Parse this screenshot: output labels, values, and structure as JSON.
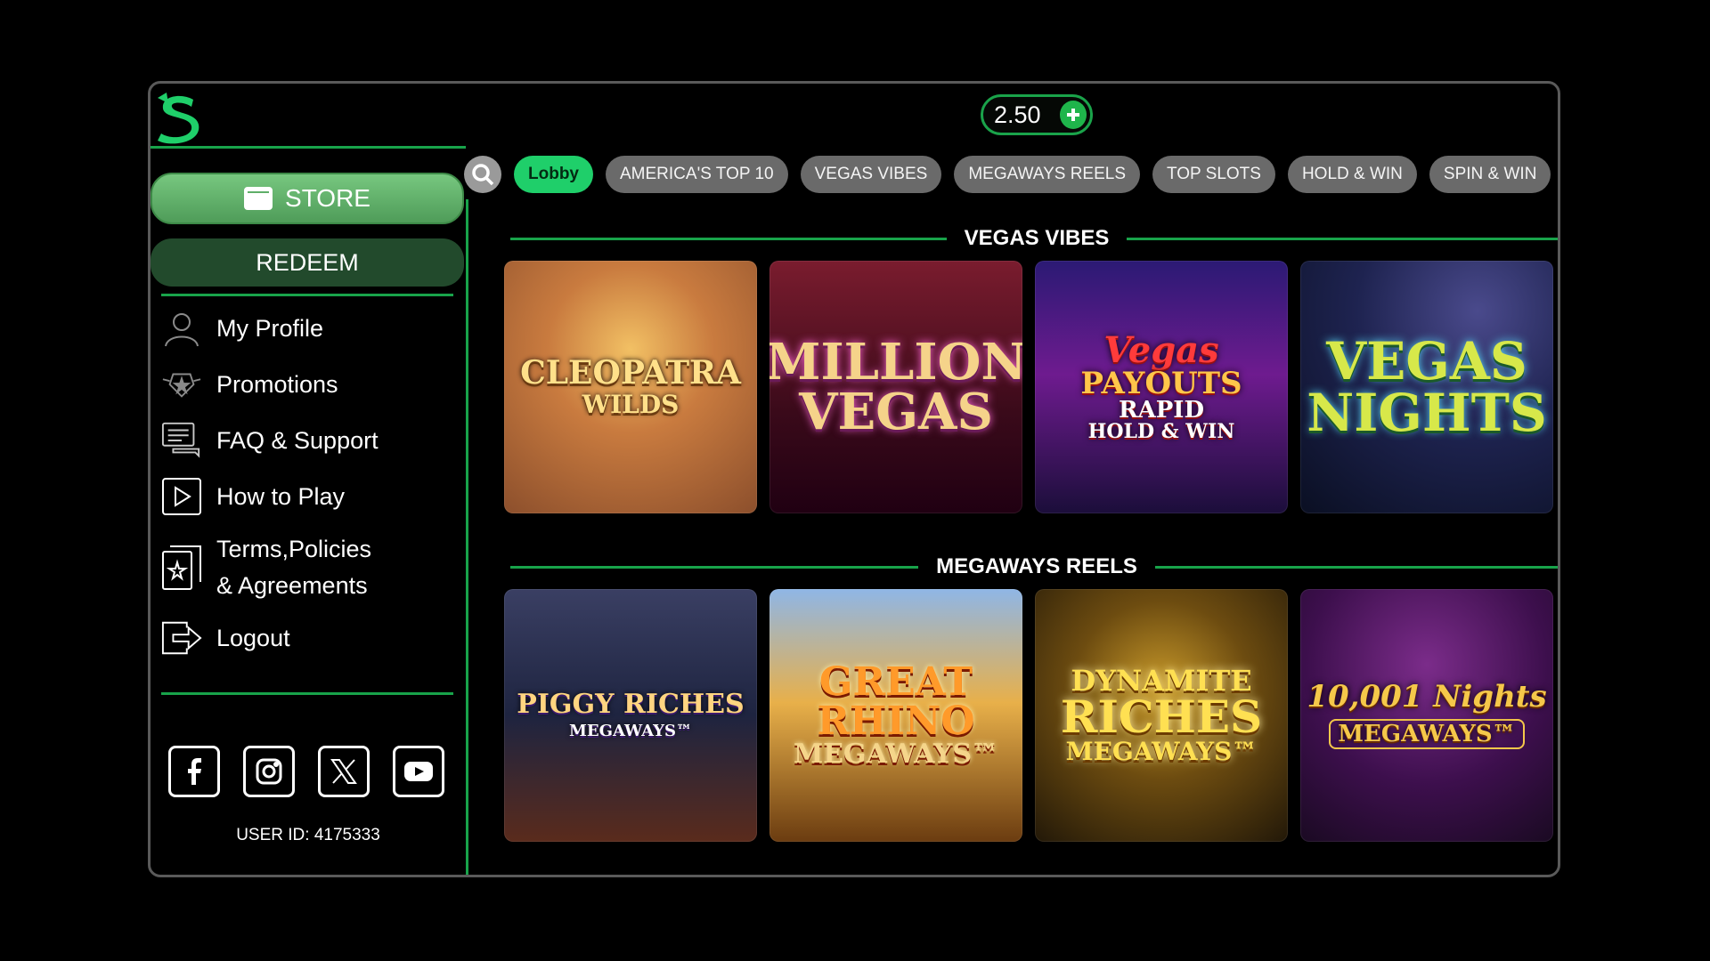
{
  "balance": {
    "amount": "2.50"
  },
  "sidebar": {
    "store_label": "STORE",
    "redeem_label": "REDEEM",
    "items": [
      {
        "label": "My Profile",
        "icon": "user-icon"
      },
      {
        "label": "Promotions",
        "icon": "badge-star-icon"
      },
      {
        "label": "FAQ & Support",
        "icon": "chat-icon"
      },
      {
        "label": "How to Play",
        "icon": "play-icon"
      },
      {
        "label": "Terms,Policies",
        "label2": "& Agreements",
        "icon": "document-star-icon"
      },
      {
        "label": "Logout",
        "icon": "logout-icon"
      }
    ],
    "socials": [
      "facebook-icon",
      "instagram-icon",
      "x-icon",
      "youtube-icon"
    ],
    "user_id": "USER ID: 4175333"
  },
  "tabs": [
    "Lobby",
    "AMERICA'S TOP 10",
    "VEGAS VIBES",
    "MEGAWAYS REELS",
    "TOP SLOTS",
    "HOLD & WIN",
    "SPIN & WIN"
  ],
  "active_tab": "Lobby",
  "sections": [
    {
      "title": "VEGAS VIBES",
      "games": [
        {
          "line1": "CLEOPATRA",
          "line2": "WILDS"
        },
        {
          "line1": "MILLION",
          "line2": "VEGAS"
        },
        {
          "line1": "Vegas",
          "line2": "PAYOUTS",
          "line3": "RAPID",
          "line4": "HOLD & WIN"
        },
        {
          "line1": "VEGAS",
          "line2": "NIGHTS"
        }
      ]
    },
    {
      "title": "MEGAWAYS REELS",
      "games": [
        {
          "line1": "PIGGY RICHES",
          "line2": "MEGAWAYS™"
        },
        {
          "line1": "GREAT",
          "line2": "RHINO",
          "line3": "MEGAWAYS™"
        },
        {
          "line1": "DYNAMITE",
          "line2": "RICHES",
          "line3": "MEGAWAYS™"
        },
        {
          "line1": "10,001 Nights",
          "line2": "MEGAWAYS™"
        }
      ]
    }
  ],
  "colors": {
    "accent": "#18a34a",
    "tab_active": "#1fcf6a",
    "tab": "#6a6a6a",
    "store": "#5fae68",
    "redeem": "#224a2c"
  }
}
